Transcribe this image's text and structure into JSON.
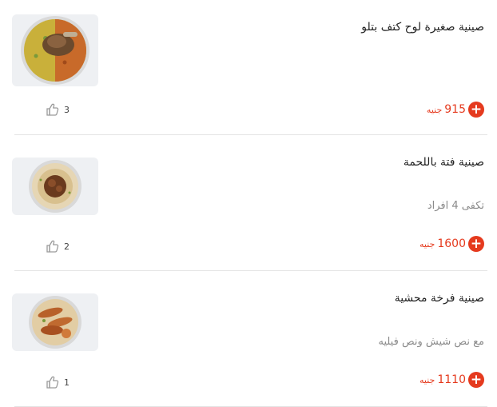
{
  "items": [
    {
      "name": "صينية صغيرة لوح كتف بتلو",
      "description": "",
      "price": "915",
      "currency": "جنيه",
      "likes": "3",
      "image_icon": "food-tray-icon"
    },
    {
      "name": "صينية فتة باللحمة",
      "description": "تكفى 4 افراد",
      "price": "1600",
      "currency": "جنيه",
      "likes": "2",
      "image_icon": "food-tray-icon"
    },
    {
      "name": "صينية فرخة محشية",
      "description": "مع نص شيش ونص فيليه",
      "price": "1110",
      "currency": "جنيه",
      "likes": "1",
      "image_icon": "food-tray-icon"
    }
  ],
  "add_button_symbol": "+",
  "colors": {
    "accent": "#e53a1e",
    "text": "#222222",
    "muted": "#8a8a8a",
    "divider": "#e4e4e4",
    "thumb_bg": "#eef0f3"
  }
}
